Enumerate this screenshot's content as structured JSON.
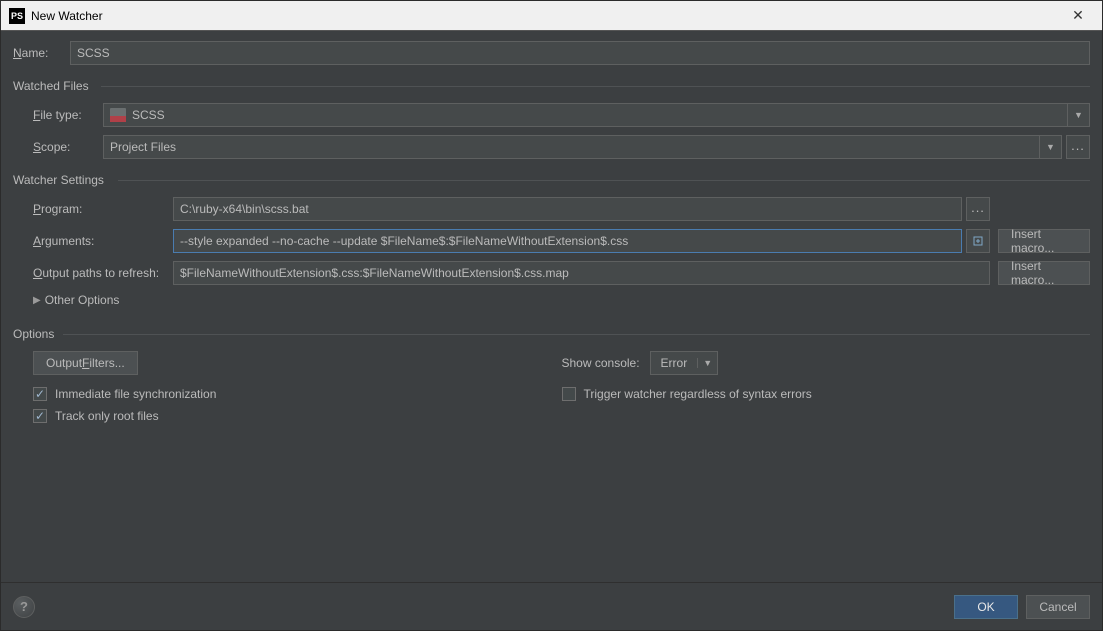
{
  "titlebar": {
    "app_icon": "PS",
    "title": "New Watcher"
  },
  "name": {
    "label": "Name:",
    "value": "SCSS"
  },
  "watched_files": {
    "header": "Watched Files",
    "file_type_label": "File type:",
    "file_type_value": "SCSS",
    "scope_label": "Scope:",
    "scope_value": "Project Files"
  },
  "watcher_settings": {
    "header": "Watcher Settings",
    "program_label": "Program:",
    "program_value": "C:\\ruby-x64\\bin\\scss.bat",
    "arguments_label": "Arguments:",
    "arguments_value": "--style expanded --no-cache --update $FileName$:$FileNameWithoutExtension$.css",
    "output_paths_label": "Output paths to refresh:",
    "output_paths_value": "$FileNameWithoutExtension$.css:$FileNameWithoutExtension$.css.map",
    "insert_macro_label": "Insert macro...",
    "other_options_label": "Other Options"
  },
  "options": {
    "header": "Options",
    "output_filters_label": "Output Filters...",
    "show_console_label": "Show console:",
    "show_console_value": "Error",
    "immediate_sync_label": "Immediate file synchronization",
    "trigger_regardless_label": "Trigger watcher regardless of syntax errors",
    "track_root_label": "Track only root files"
  },
  "footer": {
    "ok": "OK",
    "cancel": "Cancel"
  }
}
